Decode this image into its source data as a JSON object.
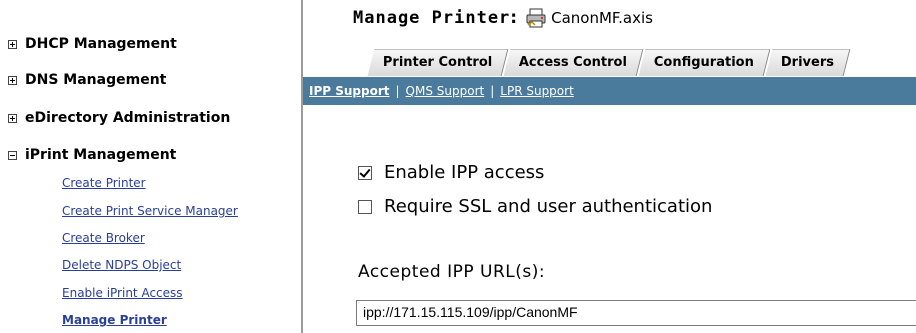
{
  "sidebar": {
    "groups": [
      {
        "label": "DHCP Management",
        "expanded": false
      },
      {
        "label": "DNS Management",
        "expanded": false
      },
      {
        "label": "eDirectory Administration",
        "expanded": false
      },
      {
        "label": "iPrint Management",
        "expanded": true
      }
    ],
    "iprint_links": [
      {
        "label": "Create Printer"
      },
      {
        "label": "Create Print Service Manager"
      },
      {
        "label": "Create Broker"
      },
      {
        "label": "Delete NDPS Object"
      },
      {
        "label": "Enable iPrint Access"
      },
      {
        "label": "Manage Printer",
        "active": true
      }
    ]
  },
  "header": {
    "title": "Manage Printer",
    "colon": ":",
    "printer_icon": "printer-icon",
    "printer_name": "CanonMF.axis"
  },
  "tabs": [
    {
      "label": "Printer Control"
    },
    {
      "label": "Access Control"
    },
    {
      "label": "Configuration"
    },
    {
      "label": "Drivers"
    }
  ],
  "subnav": {
    "links": [
      {
        "label": "IPP Support",
        "active": true
      },
      {
        "label": "QMS Support"
      },
      {
        "label": "LPR Support"
      }
    ],
    "separator": "|"
  },
  "options": {
    "enable_ipp": {
      "label": "Enable IPP access",
      "checked": true
    },
    "require_ssl": {
      "label": "Require SSL and user authentication",
      "checked": false
    }
  },
  "accepted_urls": {
    "label": "Accepted IPP URL(s):",
    "value": "ipp://171.15.115.109/ipp/CanonMF"
  },
  "colors": {
    "subnav_bg": "#4a7a9c",
    "link": "#2a3f97"
  }
}
